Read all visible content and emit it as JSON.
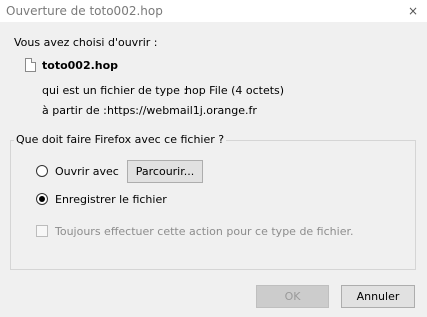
{
  "window": {
    "title": "Ouverture de toto002.hop",
    "close_icon": "×"
  },
  "info": {
    "intro": "Vous avez choisi d'ouvrir :",
    "file_icon": "file-icon",
    "filename": "toto002.hop",
    "type_label": "qui est un fichier de type :",
    "type_value": "hop File (4 octets)",
    "from_label": "à partir de :",
    "from_value": "https://webmail1j.orange.fr"
  },
  "action_group": {
    "legend": "Que doit faire Firefox avec ce fichier ?",
    "open_with": {
      "label": "Ouvrir avec",
      "selected": false
    },
    "browse_button": "Parcourir...",
    "save_file": {
      "label": "Enregistrer le fichier",
      "selected": true
    },
    "always": {
      "label": "Toujours effectuer cette action pour ce type de fichier.",
      "checked": false,
      "enabled": false
    }
  },
  "buttons": {
    "ok": "OK",
    "cancel": "Annuler"
  }
}
